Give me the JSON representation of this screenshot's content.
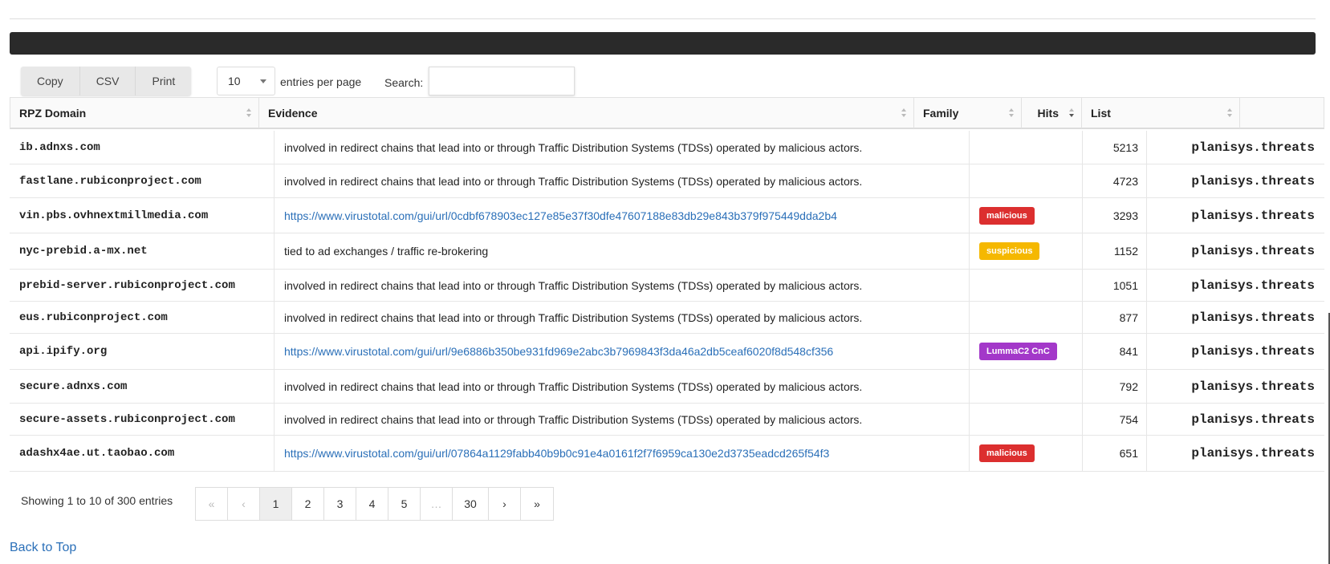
{
  "toolbar": {
    "buttons": [
      "Copy",
      "CSV",
      "Print"
    ],
    "page_length": "10",
    "page_length_label": "entries per page",
    "search_label": "Search:",
    "search_value": ""
  },
  "table": {
    "columns": [
      "RPZ Domain",
      "Evidence",
      "Family",
      "Hits",
      "List"
    ],
    "sorted_column": "Hits",
    "rows": [
      {
        "domain": "ib.adnxs.com",
        "evidence": "involved in redirect chains that lead into or through Traffic Distribution Systems (TDSs) operated by malicious actors.",
        "evidence_is_link": false,
        "family": "",
        "family_color": "",
        "hits": "5213",
        "list": "planisys.threats"
      },
      {
        "domain": "fastlane.rubiconproject.com",
        "evidence": "involved in redirect chains that lead into or through Traffic Distribution Systems (TDSs) operated by malicious actors.",
        "evidence_is_link": false,
        "family": "",
        "family_color": "",
        "hits": "4723",
        "list": "planisys.threats"
      },
      {
        "domain": "vin.pbs.ovhnextmillmedia.com",
        "evidence": "https://www.virustotal.com/gui/url/0cdbf678903ec127e85e37f30dfe47607188e83db29e843b379f975449dda2b4",
        "evidence_is_link": true,
        "family": "malicious",
        "family_color": "#dc2f2f",
        "hits": "3293",
        "list": "planisys.threats"
      },
      {
        "domain": "nyc-prebid.a-mx.net",
        "evidence": "tied to ad exchanges / traffic re-brokering",
        "evidence_is_link": false,
        "family": "suspicious",
        "family_color": "#f5b800",
        "hits": "1152",
        "list": "planisys.threats"
      },
      {
        "domain": "prebid-server.rubiconproject.com",
        "evidence": "involved in redirect chains that lead into or through Traffic Distribution Systems (TDSs) operated by malicious actors.",
        "evidence_is_link": false,
        "family": "",
        "family_color": "",
        "hits": "1051",
        "list": "planisys.threats"
      },
      {
        "domain": "eus.rubiconproject.com",
        "evidence": "involved in redirect chains that lead into or through Traffic Distribution Systems (TDSs) operated by malicious actors.",
        "evidence_is_link": false,
        "family": "",
        "family_color": "",
        "hits": "877",
        "list": "planisys.threats"
      },
      {
        "domain": "api.ipify.org",
        "evidence": "https://www.virustotal.com/gui/url/9e6886b350be931fd969e2abc3b7969843f3da46a2db5ceaf6020f8d548cf356",
        "evidence_is_link": true,
        "family": "LummaC2 CnC",
        "family_color": "#a338c9",
        "hits": "841",
        "list": "planisys.threats"
      },
      {
        "domain": "secure.adnxs.com",
        "evidence": "involved in redirect chains that lead into or through Traffic Distribution Systems (TDSs) operated by malicious actors.",
        "evidence_is_link": false,
        "family": "",
        "family_color": "",
        "hits": "792",
        "list": "planisys.threats"
      },
      {
        "domain": "secure-assets.rubiconproject.com",
        "evidence": "involved in redirect chains that lead into or through Traffic Distribution Systems (TDSs) operated by malicious actors.",
        "evidence_is_link": false,
        "family": "",
        "family_color": "",
        "hits": "754",
        "list": "planisys.threats"
      },
      {
        "domain": "adashx4ae.ut.taobao.com",
        "evidence": "https://www.virustotal.com/gui/url/07864a1129fabb40b9b0c91e4a0161f2f7f6959ca130e2d3735eadcd265f54f3",
        "evidence_is_link": true,
        "family": "malicious",
        "family_color": "#dc2f2f",
        "hits": "651",
        "list": "planisys.threats"
      }
    ]
  },
  "footer": {
    "info": "Showing 1 to 10 of 300 entries",
    "pages": [
      {
        "label": "«",
        "state": "disabled"
      },
      {
        "label": "‹",
        "state": "disabled"
      },
      {
        "label": "1",
        "state": "active"
      },
      {
        "label": "2",
        "state": "normal"
      },
      {
        "label": "3",
        "state": "normal"
      },
      {
        "label": "4",
        "state": "normal"
      },
      {
        "label": "5",
        "state": "normal"
      },
      {
        "label": "…",
        "state": "disabled"
      },
      {
        "label": "30",
        "state": "normal"
      },
      {
        "label": "›",
        "state": "normal"
      },
      {
        "label": "»",
        "state": "normal"
      }
    ],
    "back_to_top": "Back to Top"
  }
}
